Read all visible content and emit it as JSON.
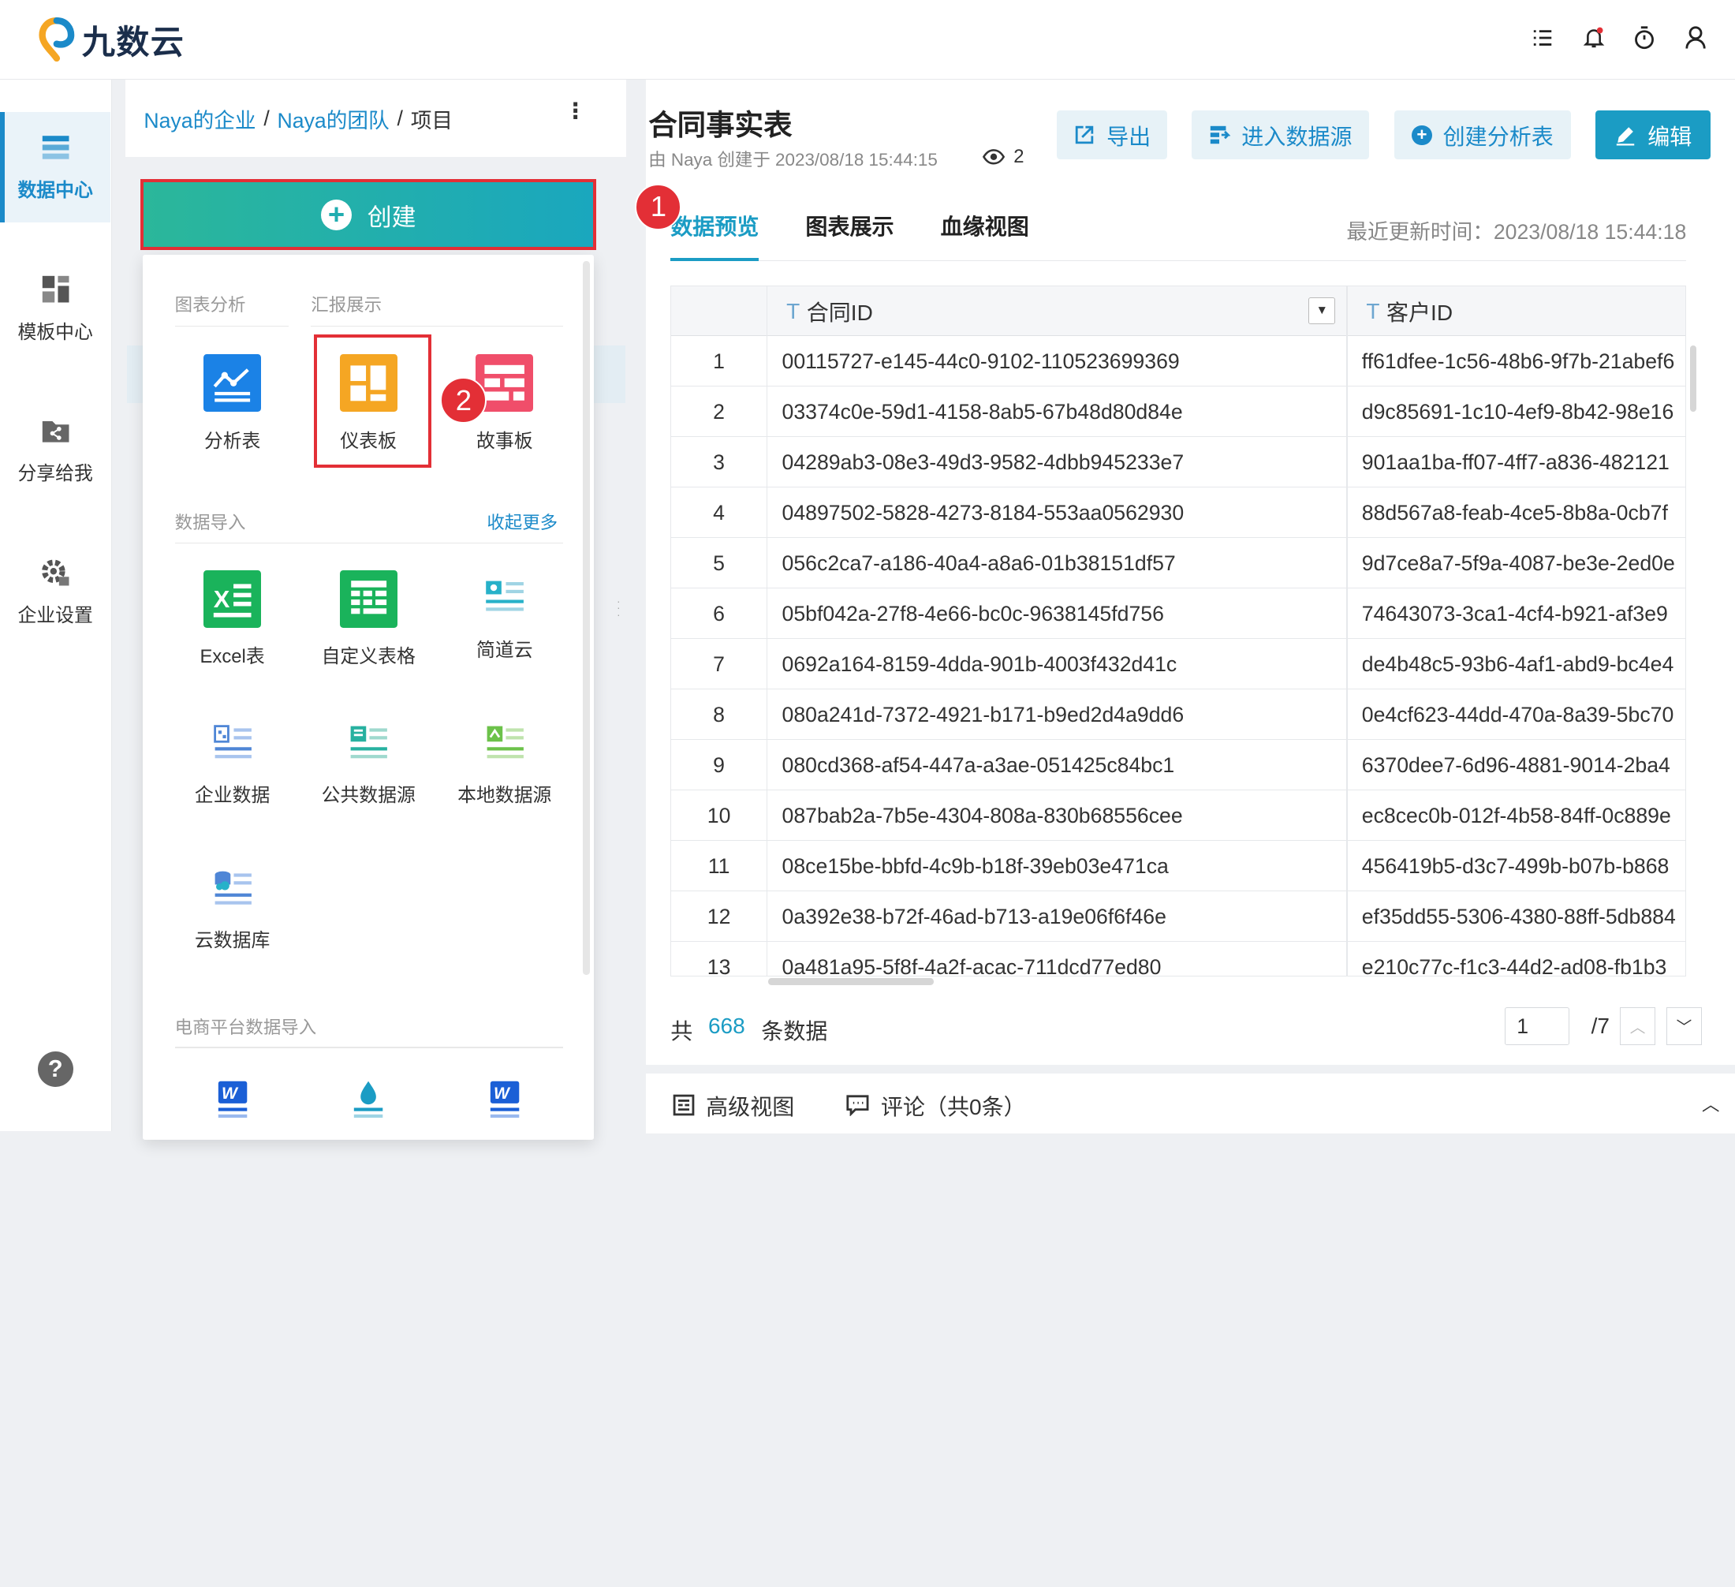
{
  "app": {
    "logo_text": "九数云"
  },
  "topbar": {
    "icons": [
      "task-list-icon",
      "bell-icon",
      "timer-icon",
      "user-icon"
    ]
  },
  "nav": {
    "items": [
      {
        "label": "数据中心",
        "icon": "data-center-icon"
      },
      {
        "label": "模板中心",
        "icon": "template-icon"
      },
      {
        "label": "分享给我",
        "icon": "share-icon"
      },
      {
        "label": "企业设置",
        "icon": "enterprise-settings-icon"
      }
    ],
    "help": "?"
  },
  "breadcrumb": {
    "items": [
      "Naya的企业",
      "Naya的团队"
    ],
    "current": "项目",
    "sep": "/",
    "more": "⋮"
  },
  "create": {
    "label": "创建"
  },
  "menu": {
    "chart_section": "图表分析",
    "report_section": "汇报展示",
    "analysis_tiles": [
      {
        "label": "分析表",
        "icon": "analysis-table-icon"
      },
      {
        "label": "仪表板",
        "icon": "dashboard-icon"
      },
      {
        "label": "故事板",
        "icon": "storyboard-icon"
      }
    ],
    "import_section": "数据导入",
    "collapse_more": "收起更多",
    "import_tiles": [
      {
        "label": "Excel表",
        "icon": "excel-icon"
      },
      {
        "label": "自定义表格",
        "icon": "custom-table-icon"
      },
      {
        "label": "简道云",
        "icon": "jiandaoyun-icon"
      },
      {
        "label": "企业数据",
        "icon": "enterprise-data-icon"
      },
      {
        "label": "公共数据源",
        "icon": "public-datasource-icon"
      },
      {
        "label": "本地数据源",
        "icon": "local-datasource-icon"
      },
      {
        "label": "云数据库",
        "icon": "cloud-database-icon"
      }
    ],
    "ecom_section": "电商平台数据导入"
  },
  "annotations": {
    "step1": "1",
    "step2": "2"
  },
  "detail": {
    "title": "合同事实表",
    "subtitle": "由 Naya 创建于 2023/08/18 15:44:15",
    "views": "2",
    "buttons": {
      "export": "导出",
      "datasource": "进入数据源",
      "create_analysis": "创建分析表",
      "edit": "编辑"
    },
    "tabs": [
      "数据预览",
      "图表展示",
      "血缘视图"
    ],
    "update_time": "最近更新时间：2023/08/18 15:44:18"
  },
  "table": {
    "type_mark": "T",
    "columns": [
      "合同ID",
      "客户ID"
    ],
    "rows": [
      [
        "1",
        "00115727-e145-44c0-9102-110523699369",
        "ff61dfee-1c56-48b6-9f7b-21abef6"
      ],
      [
        "2",
        "03374c0e-59d1-4158-8ab5-67b48d80d84e",
        "d9c85691-1c10-4ef9-8b42-98e16"
      ],
      [
        "3",
        "04289ab3-08e3-49d3-9582-4dbb945233e7",
        "901aa1ba-ff07-4ff7-a836-482121"
      ],
      [
        "4",
        "04897502-5828-4273-8184-553aa0562930",
        "88d567a8-feab-4ce5-8b8a-0cb7f"
      ],
      [
        "5",
        "056c2ca7-a186-40a4-a8a6-01b38151df57",
        "9d7ce8a7-5f9a-4087-be3e-2ed0e"
      ],
      [
        "6",
        "05bf042a-27f8-4e66-bc0c-9638145fd756",
        "74643073-3ca1-4cf4-b921-af3e9"
      ],
      [
        "7",
        "0692a164-8159-4dda-901b-4003f432d41c",
        "de4b48c5-93b6-4af1-abd9-bc4e4"
      ],
      [
        "8",
        "080a241d-7372-4921-b171-b9ed2d4a9dd6",
        "0e4cf623-44dd-470a-8a39-5bc70"
      ],
      [
        "9",
        "080cd368-af54-447a-a3ae-051425c84bc1",
        "6370dee7-6d96-4881-9014-2ba4"
      ],
      [
        "10",
        "087bab2a-7b5e-4304-808a-830b68556cee",
        "ec8cec0b-012f-4b58-84ff-0c889e"
      ],
      [
        "11",
        "08ce15be-bbfd-4c9b-b18f-39eb03e471ca",
        "456419b5-d3c7-499b-b07b-b868"
      ],
      [
        "12",
        "0a392e38-b72f-46ad-b713-a19e06f6f46e",
        "ef35dd55-5306-4380-88ff-5db884"
      ],
      [
        "13",
        "0a481a95-5f8f-4a2f-acac-711dcd77ed80",
        "e210c77c-f1c3-44d2-ad08-fb1b3"
      ]
    ]
  },
  "footer": {
    "prefix": "共",
    "count": "668",
    "suffix": "条数据",
    "page": "1",
    "total_pages": "/7"
  },
  "bottom": {
    "advanced_view": "高级视图",
    "comments": "评论（共0条）"
  },
  "colors": {
    "accent": "#1b9cc4",
    "link": "#1b8ac9",
    "highlight": "#e32f36",
    "excel": "#1ab35b",
    "analysis": "#1b82e6",
    "dashboard": "#f5a623",
    "story": "#f04e6a"
  }
}
